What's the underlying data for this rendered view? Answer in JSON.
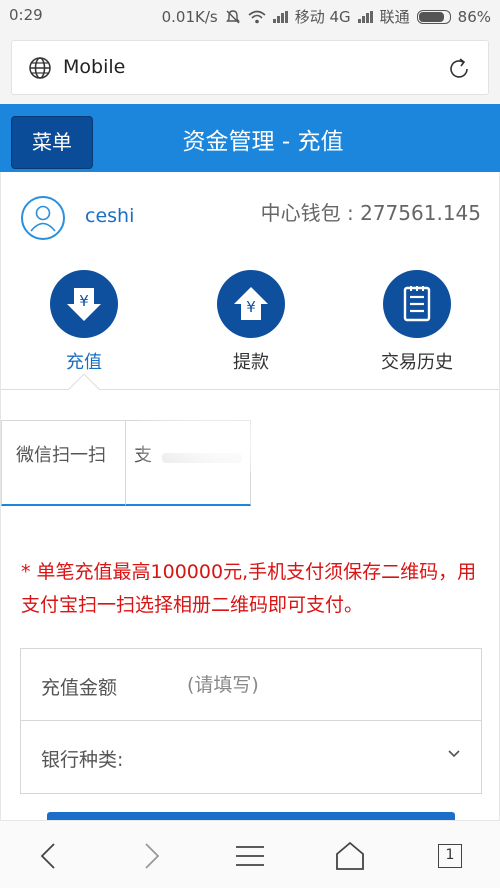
{
  "status_bar": {
    "time": "0:29",
    "speed": "0.01K/s",
    "network1": "移动 4G",
    "network2": "联通",
    "battery_percent": "86%",
    "battery_level": 0.86
  },
  "browser": {
    "url": "Mobile",
    "icons": [
      "globe-icon",
      "reload-icon"
    ]
  },
  "header": {
    "menu_label": "菜单",
    "title": "资金管理 - 充值"
  },
  "user": {
    "name": "ceshi",
    "wallet_label": "中心钱包 : 277561.145"
  },
  "actions": [
    {
      "label": "充值",
      "icon": "deposit-yen-down-icon",
      "active": true
    },
    {
      "label": "提款",
      "icon": "withdraw-yen-up-icon",
      "active": false
    },
    {
      "label": "交易历史",
      "icon": "transaction-history-icon",
      "active": false
    }
  ],
  "payment_tabs": [
    {
      "label": "微信扫一扫"
    },
    {
      "label": "支"
    }
  ],
  "notice": "* 单笔充值最高100000元,手机支付须保存二维码，用支付宝扫一扫选择相册二维码即可支付。",
  "form": {
    "amount_label": "充值金额",
    "amount_placeholder": "(请填写)",
    "bank_label": "银行种类:",
    "bank_value": ""
  },
  "bottom_nav": {
    "tab_count": "1",
    "icons": [
      "back-icon",
      "forward-icon",
      "menu-icon",
      "home-icon",
      "tabs-icon"
    ]
  },
  "colors": {
    "header_blue": "#1c86dc",
    "menu_button": "#0a4c97",
    "icon_circle": "#0e4f9e",
    "notice_red": "#d81414"
  }
}
